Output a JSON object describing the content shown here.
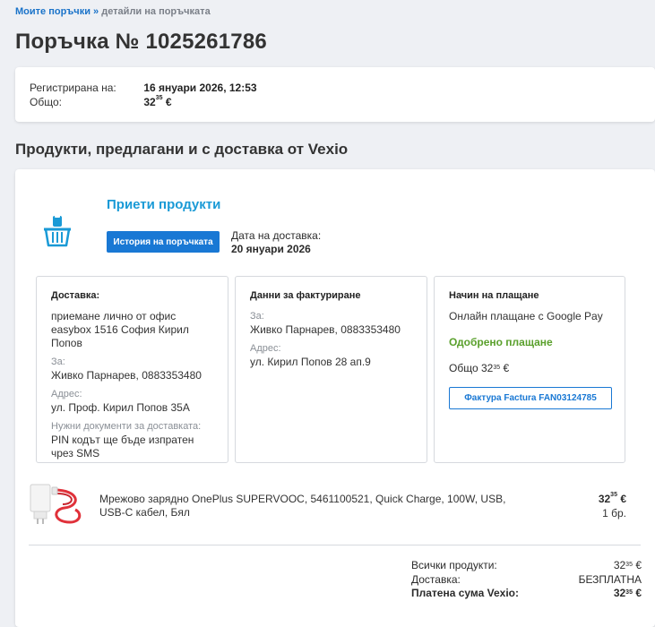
{
  "breadcrumb": {
    "parent": "Моите поръчки",
    "separator": "»",
    "current": "детайли на поръчката"
  },
  "order": {
    "title": "Поръчка № 1025261786",
    "registered_label": "Регистрирана на:",
    "registered_value": "16 януари 2026, 12:53",
    "total_label": "Общо:",
    "total_main": "32",
    "total_cents": "35",
    "currency": "€"
  },
  "section_title": "Продукти, предлагани и с доставка от Vexio",
  "shipment": {
    "status": "Приети продукти",
    "history_button": "История на поръчката",
    "delivery_date_label": "Дата на доставка:",
    "delivery_date_value": "20 януари 2026"
  },
  "delivery_box": {
    "header": "Доставка:",
    "method": "приемане лично от офис easybox 1516 София Кирил Попов",
    "for_label": "За:",
    "for_value": "Живко Парнарев, 0883353480",
    "address_label": "Адрес:",
    "address_value": "ул. Проф. Кирил Попов 35А",
    "docs_label": "Нужни документи за доставката:",
    "docs_value": "PIN кодът ще бъде изпратен чрез SMS"
  },
  "billing_box": {
    "header": "Данни за фактуриране",
    "for_label": "За:",
    "for_value": "Живко Парнарев, 0883353480",
    "address_label": "Адрес:",
    "address_value": "ул. Кирил Попов 28 ап.9"
  },
  "payment_box": {
    "header": "Начин на плащане",
    "method": "Онлайн плащане с Google Pay",
    "status": "Одобрено плащане",
    "total_label": "Общо",
    "total_main": "32",
    "total_cents": "35",
    "currency": "€",
    "invoice_button": "Фактура Factura FAN03124785"
  },
  "product": {
    "name": "Мрежово зарядно OnePlus SUPERVOOC, 5461100521, Quick Charge, 100W, USB, USB-C кабел, Бял",
    "price_main": "32",
    "price_cents": "35",
    "currency": "€",
    "qty": "1 бр."
  },
  "totals": {
    "products_label": "Всички продукти:",
    "products_main": "32",
    "products_cents": "35",
    "delivery_label": "Доставка:",
    "delivery_value": "БЕЗПЛАТНА",
    "paid_label": "Платена сума Vexio:",
    "paid_main": "32",
    "paid_cents": "35",
    "currency": "€"
  },
  "colors": {
    "accent": "#1978d4",
    "status_blue": "#1a9ad6",
    "success": "#5aa02c",
    "cable_red": "#e0313a"
  }
}
